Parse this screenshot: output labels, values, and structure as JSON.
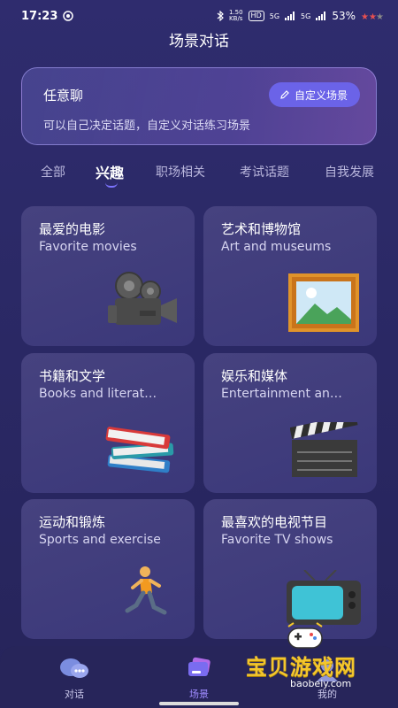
{
  "status_bar": {
    "time": "17:23",
    "net_speed": "1.50\nKB/s",
    "hd_label": "HD",
    "signal1": "5G",
    "signal2": "5G",
    "battery": "53%"
  },
  "header": {
    "title": "场景对话"
  },
  "custom_scene": {
    "title": "任意聊",
    "description": "可以自己决定话题，自定义对话练习场景",
    "button_label": "自定义场景"
  },
  "tabs": [
    {
      "label": "全部",
      "active": false
    },
    {
      "label": "兴趣",
      "active": true
    },
    {
      "label": "职场相关",
      "active": false
    },
    {
      "label": "考试话题",
      "active": false
    },
    {
      "label": "自我发展",
      "active": false
    }
  ],
  "cards": [
    {
      "title": "最爱的电影",
      "subtitle": "Favorite movies",
      "icon": "movie-camera-icon"
    },
    {
      "title": "艺术和博物馆",
      "subtitle": "Art and museums",
      "icon": "framed-picture-icon"
    },
    {
      "title": "书籍和文学",
      "subtitle": "Books and literat…",
      "icon": "books-icon"
    },
    {
      "title": "娱乐和媒体",
      "subtitle": "Entertainment an…",
      "icon": "clapper-board-icon"
    },
    {
      "title": "运动和锻炼",
      "subtitle": "Sports and exercise",
      "icon": "runner-icon"
    },
    {
      "title": "最喜欢的电视节目",
      "subtitle": "Favorite TV shows",
      "icon": "television-icon"
    }
  ],
  "bottom_nav": [
    {
      "label": "对话",
      "icon": "chat-bubbles-icon",
      "active": false
    },
    {
      "label": "场景",
      "icon": "scene-cards-icon",
      "active": true
    },
    {
      "label": "我的",
      "icon": "profile-icon",
      "active": false
    }
  ],
  "watermark": {
    "text": "宝贝游戏网",
    "url": "baobeiy.com"
  },
  "colors": {
    "accent": "#6b63e8",
    "background": "#2b2966",
    "card": "#423f7e",
    "watermark": "#f4c62d"
  }
}
